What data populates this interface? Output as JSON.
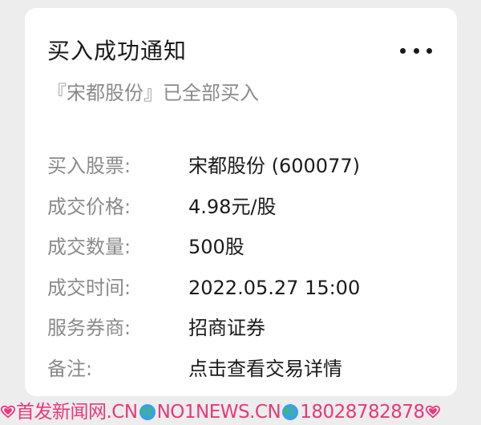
{
  "card": {
    "title": "买入成功通知",
    "more_icon": "more-horizontal-icon",
    "subtitle": "『宋都股份』已全部买入",
    "rows": [
      {
        "label": "买入股票:",
        "value": "宋都股份 (600077)"
      },
      {
        "label": "成交价格:",
        "value": "4.98元/股"
      },
      {
        "label": "成交数量:",
        "value": "500股"
      },
      {
        "label": "成交时间:",
        "value": "2022.05.27 15:00"
      },
      {
        "label": "服务券商:",
        "value": "招商证券"
      },
      {
        "label": "备注:",
        "value": "点击查看交易详情"
      }
    ]
  },
  "watermark": {
    "segments": [
      "首发新闻网.CN",
      "NO1NEWS.CN",
      "18028782878"
    ],
    "color": "#e8387c",
    "icons": [
      "heart-icon",
      "globe-icon"
    ]
  }
}
